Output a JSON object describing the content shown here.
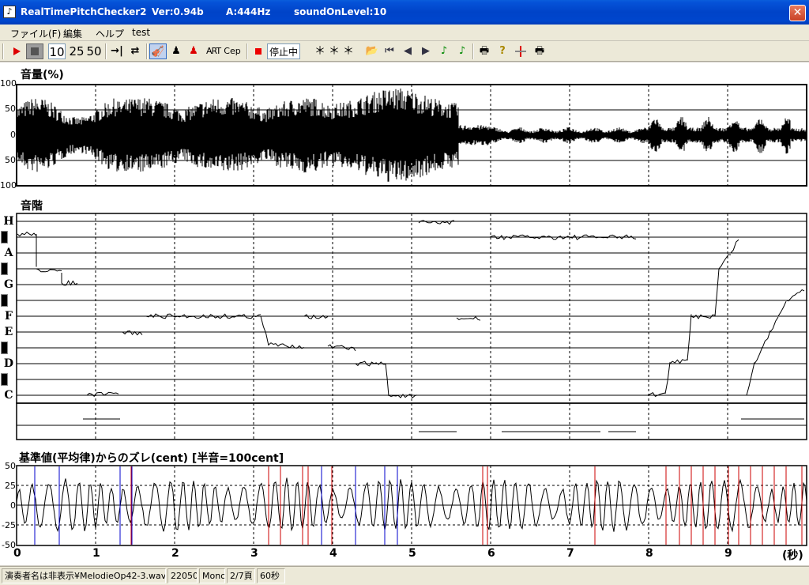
{
  "window": {
    "app_title": "RealTimePitchChecker2",
    "version": "Ver:0.94b",
    "a_freq": "A:444Hz",
    "sound_level": "soundOnLevel:10",
    "close_glyph": "✕"
  },
  "menu": [
    "ファイル(F)",
    "編集",
    "ヘルプ",
    "test"
  ],
  "toolbar": {
    "play_icon": "play-icon",
    "stop_icon": "stop-icon",
    "speed": [
      "10",
      "25",
      "50"
    ],
    "art": "ART",
    "cep": "Cep",
    "status_label": "停止中",
    "stars": "＊＊＊"
  },
  "volume_panel": {
    "title": "音量(%)",
    "y_labels": [
      "100",
      "50",
      "0",
      "50",
      "100"
    ]
  },
  "scale_panel": {
    "title": "音階",
    "notes": [
      "H",
      "A",
      "G",
      "F",
      "E",
      "D",
      "C"
    ]
  },
  "deviation_panel": {
    "title": "基準値(平均律)からのズレ(cent) [半音=100cent]",
    "y_labels": [
      "50",
      "25",
      "0",
      "-25",
      "-50"
    ]
  },
  "x_axis": {
    "ticks": [
      "0",
      "1",
      "2",
      "3",
      "4",
      "5",
      "6",
      "7",
      "8",
      "9"
    ],
    "unit": "(秒)"
  },
  "statusbar": {
    "file": "演奏者名は非表示¥MelodieOp42-3.wav",
    "rate": "22050",
    "channel": "Mono",
    "page": "2/7頁",
    "duration": "60秒"
  },
  "colors": {
    "title_bar": "#0043c8",
    "blue_marker": "#0000cc",
    "red_marker": "#cc0000"
  }
}
